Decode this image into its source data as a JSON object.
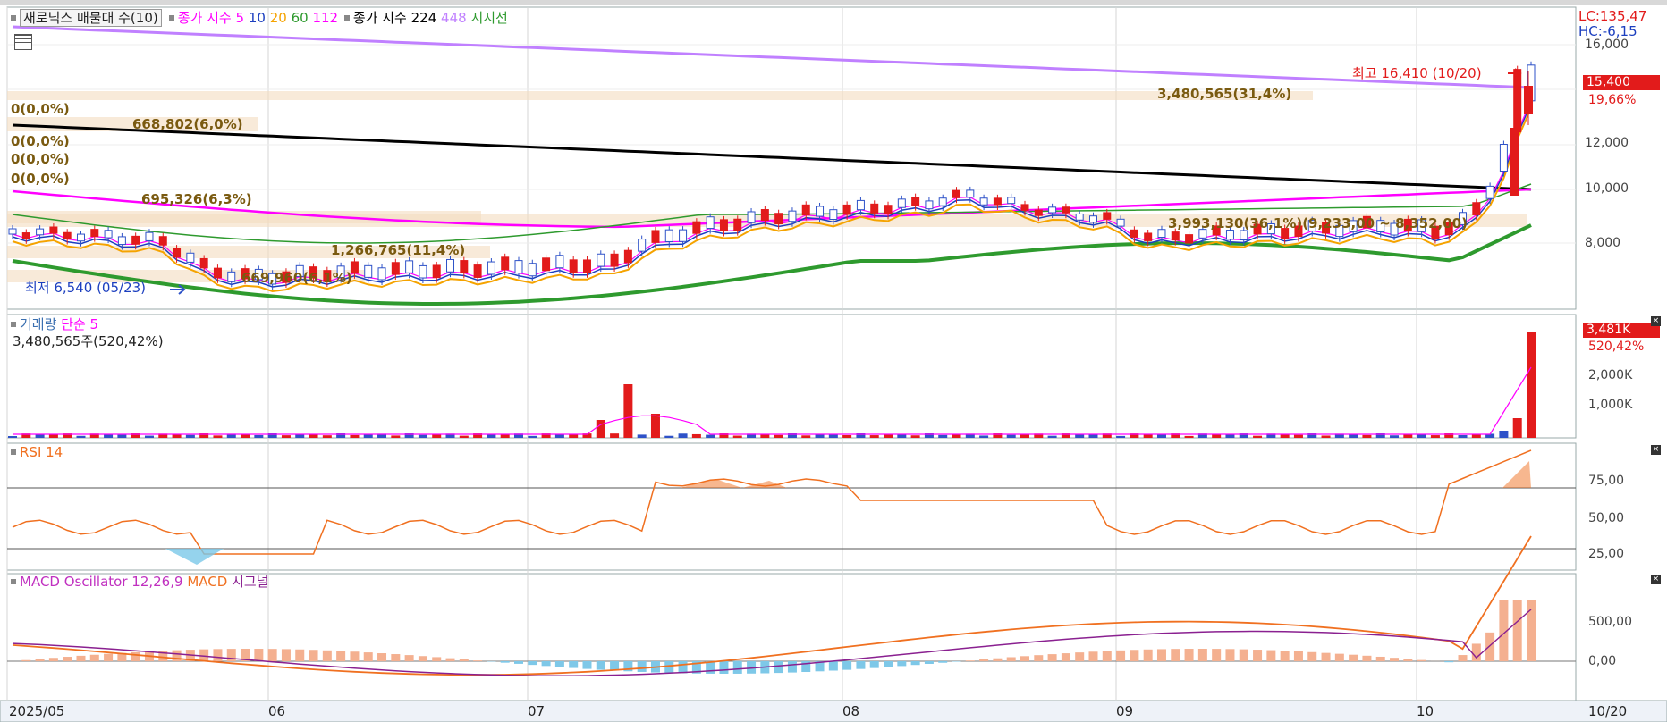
{
  "main_panel": {
    "title_button": "새로닉스 매물대 수(10)",
    "ma_label": "종가 지수",
    "ma_periods": [
      "5",
      "10",
      "20",
      "60",
      "112"
    ],
    "ma_colors": [
      "#ff00ff",
      "#1c3fbf",
      "#f5a300",
      "#2e9a2e",
      "#ff00ff"
    ],
    "long_ma_label": "종가 지수",
    "long_ma_periods": [
      "224",
      "448"
    ],
    "support_label": "지지선",
    "lc_label": "LC:135,47",
    "hc_label": "HC:-6,15",
    "price_tag": "15,400",
    "change_pct": "19,66%",
    "high_annotation": "최고 16,410 (10/20)",
    "low_annotation": "최저 6,540 (05/23)",
    "y_ticks": [
      "16,000",
      "14,000",
      "12,000",
      "10,000",
      "8,000"
    ],
    "volume_profile_labels": [
      "0(0,0%)",
      "668,802(6,0%)",
      "0(0,0%)",
      "0(0,0%)",
      "0(0,0%)",
      "695,326(6,3%)",
      "1,266,765(11,4%)",
      "669,960(6,1%)",
      "3,480,565(31,4%)",
      "3,993,130(36,1%)(9,233,00 ~ 8,352,00)"
    ]
  },
  "volume_panel": {
    "title": "거래량",
    "ma_label": "단순 5",
    "volume_value": "3,480,565주(520,42%)",
    "tag": "3,481K",
    "tag_pct": "520,42%",
    "y_ticks": [
      "2,000K",
      "1,000K"
    ]
  },
  "rsi_panel": {
    "title": "RSI 14",
    "y_ticks": [
      "75,00",
      "50,00",
      "25,00"
    ]
  },
  "macd_panel": {
    "title": "MACD Oscillator 12,26,9",
    "macd_label": "MACD",
    "signal_label": "시그널",
    "y_ticks": [
      "500,00",
      "0,00"
    ]
  },
  "x_axis": {
    "labels": [
      "2025/05",
      "06",
      "07",
      "08",
      "09",
      "10"
    ],
    "right_label": "10/20"
  },
  "colors": {
    "up": "#e21b1b",
    "down": "#2e52c8",
    "ma5": "#ff00ff",
    "ma10": "#1c3fbf",
    "ma20": "#f5a300",
    "ma60": "#2e9a2e",
    "ma112": "#ff00ff",
    "ma224": "#000000",
    "ma448": "#c080ff",
    "rsi": "#f07020",
    "macd": "#f07020",
    "signal": "#8a2090"
  },
  "chart_data": [
    {
      "type": "line",
      "title": "새로닉스",
      "x": [
        "2025/05",
        "06",
        "07",
        "08",
        "09",
        "10",
        "10/20"
      ],
      "series": [
        {
          "name": "종가",
          "values": [
            8200,
            6800,
            7000,
            9000,
            8000,
            8600,
            15400
          ]
        }
      ],
      "ylim": [
        6000,
        16600
      ],
      "high": 16410,
      "low": 6540
    },
    {
      "type": "bar",
      "title": "거래량",
      "series": [
        {
          "name": "거래량",
          "values": [
            3480565
          ]
        }
      ],
      "ylim": [
        0,
        3500000
      ]
    },
    {
      "type": "line",
      "title": "RSI 14",
      "ylim": [
        20,
        100
      ]
    },
    {
      "type": "bar",
      "title": "MACD Oscillator 12,26,9",
      "ylim": [
        -300,
        900
      ]
    }
  ]
}
